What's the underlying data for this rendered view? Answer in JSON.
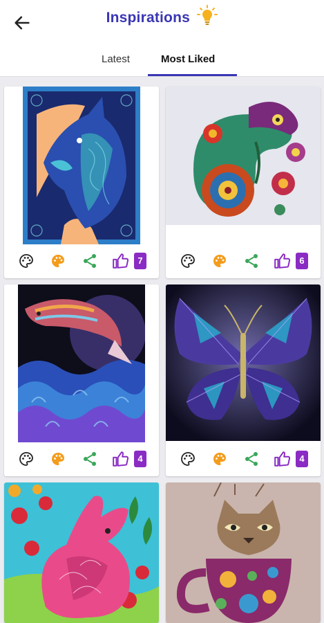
{
  "header": {
    "title": "Inspirations",
    "back_icon": "arrow-left-icon",
    "title_icon": "lightbulb-icon"
  },
  "tabs": [
    {
      "label": "Latest",
      "active": false
    },
    {
      "label": "Most Liked",
      "active": true
    }
  ],
  "colors": {
    "accent": "#3a36b4",
    "badge": "#8a2bc4",
    "palette_orange": "#f39c1c",
    "share_green": "#3aa65a",
    "like_purple": "#8a2bc4"
  },
  "cards": [
    {
      "subject": "wolf",
      "likes": "7"
    },
    {
      "subject": "chameleon",
      "likes": "6"
    },
    {
      "subject": "dolphin",
      "likes": "4"
    },
    {
      "subject": "butterfly",
      "likes": "4"
    },
    {
      "subject": "rabbit",
      "likes": ""
    },
    {
      "subject": "cat in cup",
      "likes": ""
    }
  ],
  "card_actions": {
    "icons": [
      "palette-outline-icon",
      "palette-filled-icon",
      "share-icon",
      "thumb-up-icon"
    ]
  }
}
